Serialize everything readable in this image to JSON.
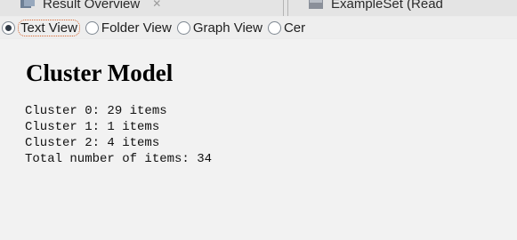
{
  "tabs": [
    {
      "label": "Result Overview",
      "icon": "result-overview-icon",
      "closable": true
    },
    {
      "label": "ExampleSet (Read",
      "icon": "exampleset-icon",
      "closable": false
    }
  ],
  "views": {
    "options": [
      {
        "label": "Text View",
        "selected": true,
        "focused": true
      },
      {
        "label": "Folder View",
        "selected": false,
        "focused": false
      },
      {
        "label": "Graph View",
        "selected": false,
        "focused": false
      },
      {
        "label": "Cer",
        "selected": false,
        "focused": false
      }
    ]
  },
  "model": {
    "title": "Cluster Model",
    "lines": [
      "Cluster 0: 29 items",
      "Cluster 1: 1 items",
      "Cluster 2: 4 items",
      "Total number of items: 34"
    ]
  },
  "colors": {
    "focus_ring": "#d7662f",
    "background": "#f2f2f2"
  }
}
